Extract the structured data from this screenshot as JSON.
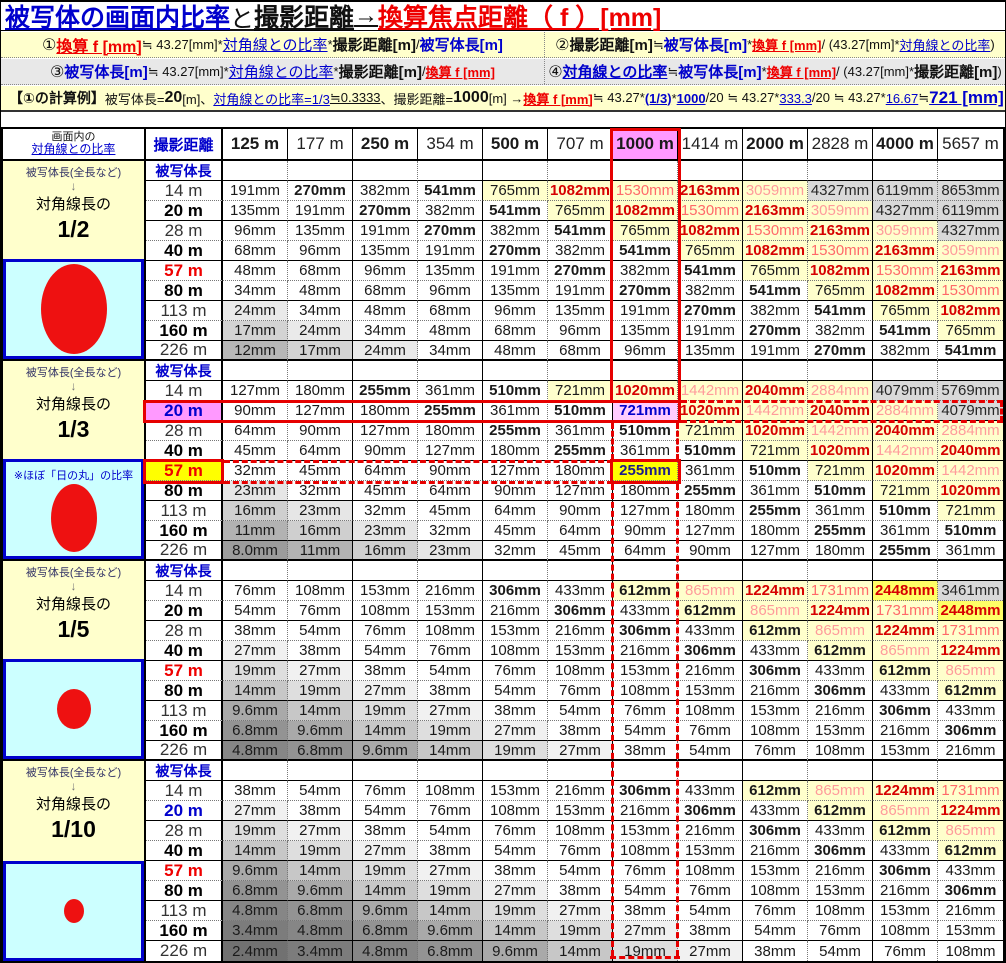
{
  "title": {
    "segments": [
      {
        "t": "被写体の画面内比率",
        "s": "title-blue"
      },
      {
        "t": "と",
        "s": "title-k"
      },
      {
        "t": "撮影距離",
        "s": "title-kb"
      },
      {
        "t": " → ",
        "s": "title-k"
      },
      {
        "t": "換算焦点距離（ f ）[mm]",
        "s": "title-red"
      }
    ]
  },
  "formulas": {
    "f1": [
      {
        "t": "①",
        "s": "cn"
      },
      {
        "t": "換算 f [mm]",
        "s": "ru-x"
      },
      {
        "t": " ≒ 43.27[mm]*",
        "s": "k"
      },
      {
        "t": "対角線との比率",
        "s": "bu-x"
      },
      {
        "t": "*",
        "s": "k"
      },
      {
        "t": "撮影距離[m]",
        "s": "kx"
      },
      {
        "t": " / ",
        "s": "k"
      },
      {
        "t": "被写体長[m]",
        "s": "bx"
      }
    ],
    "f2": [
      {
        "t": "②",
        "s": "cn"
      },
      {
        "t": "撮影距離[m]",
        "s": "kx"
      },
      {
        "t": " ≒ ",
        "s": "k"
      },
      {
        "t": "被写体長[m]",
        "s": "bx"
      },
      {
        "t": "*",
        "s": "k"
      },
      {
        "t": "換算 f [mm]",
        "s": "ru"
      },
      {
        "t": " / (43.27[mm]*",
        "s": "k"
      },
      {
        "t": "対角線との比率",
        "s": "bu"
      },
      {
        "t": ")",
        "s": "k"
      }
    ],
    "f3": [
      {
        "t": "③",
        "s": "cn"
      },
      {
        "t": "被写体長[m]",
        "s": "bx"
      },
      {
        "t": " ≒ 43.27[mm]*",
        "s": "k"
      },
      {
        "t": "対角線との比率",
        "s": "bu-x"
      },
      {
        "t": "*",
        "s": "k"
      },
      {
        "t": "撮影距離[m]",
        "s": "kx"
      },
      {
        "t": " / ",
        "s": "k"
      },
      {
        "t": "換算 f [mm]",
        "s": "ru"
      }
    ],
    "f4": [
      {
        "t": "④",
        "s": "cn"
      },
      {
        "t": "対角線との比率",
        "s": "bux2"
      },
      {
        "t": " ≒ ",
        "s": "k"
      },
      {
        "t": "被写体長[m]",
        "s": "bx"
      },
      {
        "t": "*",
        "s": "k"
      },
      {
        "t": "換算 f [mm]",
        "s": "ru"
      },
      {
        "t": " / (43.27[mm]*",
        "s": "k"
      },
      {
        "t": "撮影距離[m]",
        "s": "kx"
      },
      {
        "t": ")",
        "s": "k"
      }
    ]
  },
  "example": {
    "segments": [
      {
        "t": "【①の計算例】",
        "s": "kb"
      },
      {
        "t": "被写体長=",
        "s": "k"
      },
      {
        "t": "20",
        "s": "knum"
      },
      {
        "t": "[m]、",
        "s": "k"
      },
      {
        "t": "対角線との比率=1/3",
        "s": "bu"
      },
      {
        "t": "≒0.3333",
        "s": "ku"
      },
      {
        "t": "、撮影距離=",
        "s": "k"
      },
      {
        "t": "1000",
        "s": "knum"
      },
      {
        "t": "[m] → ",
        "s": "k"
      },
      {
        "t": "換算 f [mm]",
        "s": "ru"
      },
      {
        "t": " ≒ 43.27*",
        "s": "k"
      },
      {
        "t": "(1/3)",
        "s": "bub"
      },
      {
        "t": "*",
        "s": "k"
      },
      {
        "t": "1000",
        "s": "bub"
      },
      {
        "t": "/20 ≒ 43.27*",
        "s": "k"
      },
      {
        "t": "333.3",
        "s": "bu"
      },
      {
        "t": "/20 ≒ 43.27*",
        "s": "k"
      },
      {
        "t": "16.67",
        "s": "bu"
      },
      {
        "t": " ≒ ",
        "s": "k"
      },
      {
        "t": "721 [mm]",
        "s": "bunum"
      }
    ]
  },
  "table": {
    "corner": {
      "prefix": "画面内の",
      "link": "対角線との比率"
    },
    "distance_label": "撮影距離",
    "subject_label": "被写体長",
    "unit_suffix": "mm",
    "distances": [
      "125 m",
      "177 m",
      "250 m",
      "354 m",
      "500 m",
      "707 m",
      "1000 m",
      "1414 m",
      "2000 m",
      "2828 m",
      "4000 m",
      "5657 m"
    ],
    "distance_styles": [
      "b",
      "n",
      "b",
      "n",
      "b",
      "n",
      "p",
      "n",
      "b",
      "n",
      "b",
      "n"
    ],
    "subjects": [
      "14 m",
      "20 m",
      "28 m",
      "40 m",
      "57 m",
      "80 m",
      "113 m",
      "160 m",
      "226 m"
    ],
    "row_label_styles": [
      "n",
      "b",
      "n",
      "b",
      "r",
      "b",
      "n",
      "b",
      "n"
    ],
    "sidebar_lines": [
      "被写体長(全長など)",
      "↓",
      "対角線長の"
    ],
    "sections": [
      {
        "ratio": "1/2",
        "note": "",
        "circle": [
          66,
          90
        ],
        "label_overrides": {},
        "cell_overrides": {},
        "rows": [
          [
            "191",
            "270",
            "382",
            "541",
            "765",
            "1082",
            "1530",
            "2163",
            "3059",
            "4327",
            "6119",
            "8653"
          ],
          [
            "135",
            "191",
            "270",
            "382",
            "541",
            "765",
            "1082",
            "1530",
            "2163",
            "3059",
            "4327",
            "6119"
          ],
          [
            "96",
            "135",
            "191",
            "270",
            "382",
            "541",
            "765",
            "1082",
            "1530",
            "2163",
            "3059",
            "4327"
          ],
          [
            "68",
            "96",
            "135",
            "191",
            "270",
            "382",
            "541",
            "765",
            "1082",
            "1530",
            "2163",
            "3059"
          ],
          [
            "48",
            "68",
            "96",
            "135",
            "191",
            "270",
            "382",
            "541",
            "765",
            "1082",
            "1530",
            "2163"
          ],
          [
            "34",
            "48",
            "68",
            "96",
            "135",
            "191",
            "270",
            "382",
            "541",
            "765",
            "1082",
            "1530"
          ],
          [
            "24",
            "34",
            "48",
            "68",
            "96",
            "135",
            "191",
            "270",
            "382",
            "541",
            "765",
            "1082"
          ],
          [
            "17",
            "24",
            "34",
            "48",
            "68",
            "96",
            "135",
            "191",
            "270",
            "382",
            "541",
            "765"
          ],
          [
            "12",
            "17",
            "24",
            "34",
            "48",
            "68",
            "96",
            "135",
            "191",
            "270",
            "382",
            "541"
          ]
        ]
      },
      {
        "ratio": "1/3",
        "note": "※ほぼ「日の丸」の比率",
        "circle": [
          46,
          68
        ],
        "label_overrides": {
          "1": "pink",
          "4": "yel"
        },
        "cell_overrides": {
          "1,6": "pinkcell",
          "4,6": "yelcell"
        },
        "rows": [
          [
            "127",
            "180",
            "255",
            "361",
            "510",
            "721",
            "1020",
            "1442",
            "2040",
            "2884",
            "4079",
            "5769"
          ],
          [
            "90",
            "127",
            "180",
            "255",
            "361",
            "510",
            "721",
            "1020",
            "1442",
            "2040",
            "2884",
            "4079"
          ],
          [
            "64",
            "90",
            "127",
            "180",
            "255",
            "361",
            "510",
            "721",
            "1020",
            "1442",
            "2040",
            "2884"
          ],
          [
            "45",
            "64",
            "90",
            "127",
            "180",
            "255",
            "361",
            "510",
            "721",
            "1020",
            "1442",
            "2040"
          ],
          [
            "32",
            "45",
            "64",
            "90",
            "127",
            "180",
            "255",
            "361",
            "510",
            "721",
            "1020",
            "1442"
          ],
          [
            "23",
            "32",
            "45",
            "64",
            "90",
            "127",
            "180",
            "255",
            "361",
            "510",
            "721",
            "1020"
          ],
          [
            "16",
            "23",
            "32",
            "45",
            "64",
            "90",
            "127",
            "180",
            "255",
            "361",
            "510",
            "721"
          ],
          [
            "11",
            "16",
            "23",
            "32",
            "45",
            "64",
            "90",
            "127",
            "180",
            "255",
            "361",
            "510"
          ],
          [
            "8.0",
            "11",
            "16",
            "23",
            "32",
            "45",
            "64",
            "90",
            "127",
            "180",
            "255",
            "361"
          ]
        ]
      },
      {
        "ratio": "1/5",
        "note": "",
        "circle": [
          34,
          40
        ],
        "label_overrides": {},
        "cell_overrides": {},
        "rows": [
          [
            "76",
            "108",
            "153",
            "216",
            "306",
            "433",
            "612",
            "865",
            "1224",
            "1731",
            "2448",
            "3461"
          ],
          [
            "54",
            "76",
            "108",
            "153",
            "216",
            "306",
            "433",
            "612",
            "865",
            "1224",
            "1731",
            "2448"
          ],
          [
            "38",
            "54",
            "76",
            "108",
            "153",
            "216",
            "306",
            "433",
            "612",
            "865",
            "1224",
            "1731"
          ],
          [
            "27",
            "38",
            "54",
            "76",
            "108",
            "153",
            "216",
            "306",
            "433",
            "612",
            "865",
            "1224"
          ],
          [
            "19",
            "27",
            "38",
            "54",
            "76",
            "108",
            "153",
            "216",
            "306",
            "433",
            "612",
            "865"
          ],
          [
            "14",
            "19",
            "27",
            "38",
            "54",
            "76",
            "108",
            "153",
            "216",
            "306",
            "433",
            "612"
          ],
          [
            "9.6",
            "14",
            "19",
            "27",
            "38",
            "54",
            "76",
            "108",
            "153",
            "216",
            "306",
            "433"
          ],
          [
            "6.8",
            "9.6",
            "14",
            "19",
            "27",
            "38",
            "54",
            "76",
            "108",
            "153",
            "216",
            "306"
          ],
          [
            "4.8",
            "6.8",
            "9.6",
            "14",
            "19",
            "27",
            "38",
            "54",
            "76",
            "108",
            "153",
            "216"
          ]
        ]
      },
      {
        "ratio": "1/10",
        "note": "",
        "circle": [
          20,
          24
        ],
        "label_overrides": {
          "1": "blue"
        },
        "cell_overrides": {},
        "rows": [
          [
            "38",
            "54",
            "76",
            "108",
            "153",
            "216",
            "306",
            "433",
            "612",
            "865",
            "1224",
            "1731"
          ],
          [
            "27",
            "38",
            "54",
            "76",
            "108",
            "153",
            "216",
            "306",
            "433",
            "612",
            "865",
            "1224"
          ],
          [
            "19",
            "27",
            "38",
            "54",
            "76",
            "108",
            "153",
            "216",
            "306",
            "433",
            "612",
            "865"
          ],
          [
            "14",
            "19",
            "27",
            "38",
            "54",
            "76",
            "108",
            "153",
            "216",
            "306",
            "433",
            "612"
          ],
          [
            "9.6",
            "14",
            "19",
            "27",
            "38",
            "54",
            "76",
            "108",
            "153",
            "216",
            "306",
            "433"
          ],
          [
            "6.8",
            "9.6",
            "14",
            "19",
            "27",
            "38",
            "54",
            "76",
            "108",
            "153",
            "216",
            "306"
          ],
          [
            "4.8",
            "6.8",
            "9.6",
            "14",
            "19",
            "27",
            "38",
            "54",
            "76",
            "108",
            "153",
            "216"
          ],
          [
            "3.4",
            "4.8",
            "6.8",
            "9.6",
            "14",
            "19",
            "27",
            "38",
            "54",
            "76",
            "108",
            "153"
          ],
          [
            "2.4",
            "3.4",
            "4.8",
            "6.8",
            "9.6",
            "14",
            "19",
            "27",
            "38",
            "54",
            "76",
            "108"
          ]
        ]
      }
    ],
    "value_styles": {
      "2.4": "g15",
      "3.4": "g14",
      "4.8": "g13",
      "6.8": "g12",
      "8.0": "g11",
      "9.6": "g10",
      "11": "g9",
      "12": "g8",
      "14": "g7",
      "16": "g6",
      "17": "g5",
      "19": "g4",
      "23": "g3",
      "24": "g2",
      "27": "g1",
      "32": "w",
      "34": "w",
      "38": "w",
      "45": "w",
      "48": "w",
      "54": "w",
      "64": "w",
      "68": "w",
      "76": "w",
      "90": "w",
      "96": "w",
      "108": "w",
      "127": "w",
      "135": "w",
      "153": "w",
      "180": "w",
      "191": "w",
      "216": "w",
      "361": "w",
      "382": "w",
      "433": "w",
      "255": "b",
      "270": "b",
      "306": "b",
      "510": "b",
      "541": "b",
      "612": "yb",
      "721": "y",
      "765": "y",
      "865": "ys",
      "1442": "ys",
      "2884": "ys",
      "3059": "ys",
      "1530": "ym",
      "1731": "ym",
      "1020": "yr",
      "1082": "yr",
      "1224": "yr",
      "2040": "yr",
      "2163": "yr",
      "2448": "ybr",
      "3461": "gy",
      "4079": "gy",
      "4327": "gy",
      "5769": "gy",
      "6119": "gy",
      "8653": "gy"
    }
  },
  "colors": {
    "accent_red": "#e60000",
    "pale_yellow": "#ffffcc",
    "bright_yellow": "#ffff66",
    "highlight_yellow": "#ffff00",
    "pink_header": "#ff99ff",
    "pink_cell": "#ffccff",
    "gray_cell": "#d9d9d9",
    "blue": "#0000cc",
    "circle_red": "#ee1111",
    "cyan": "#ccffff"
  }
}
